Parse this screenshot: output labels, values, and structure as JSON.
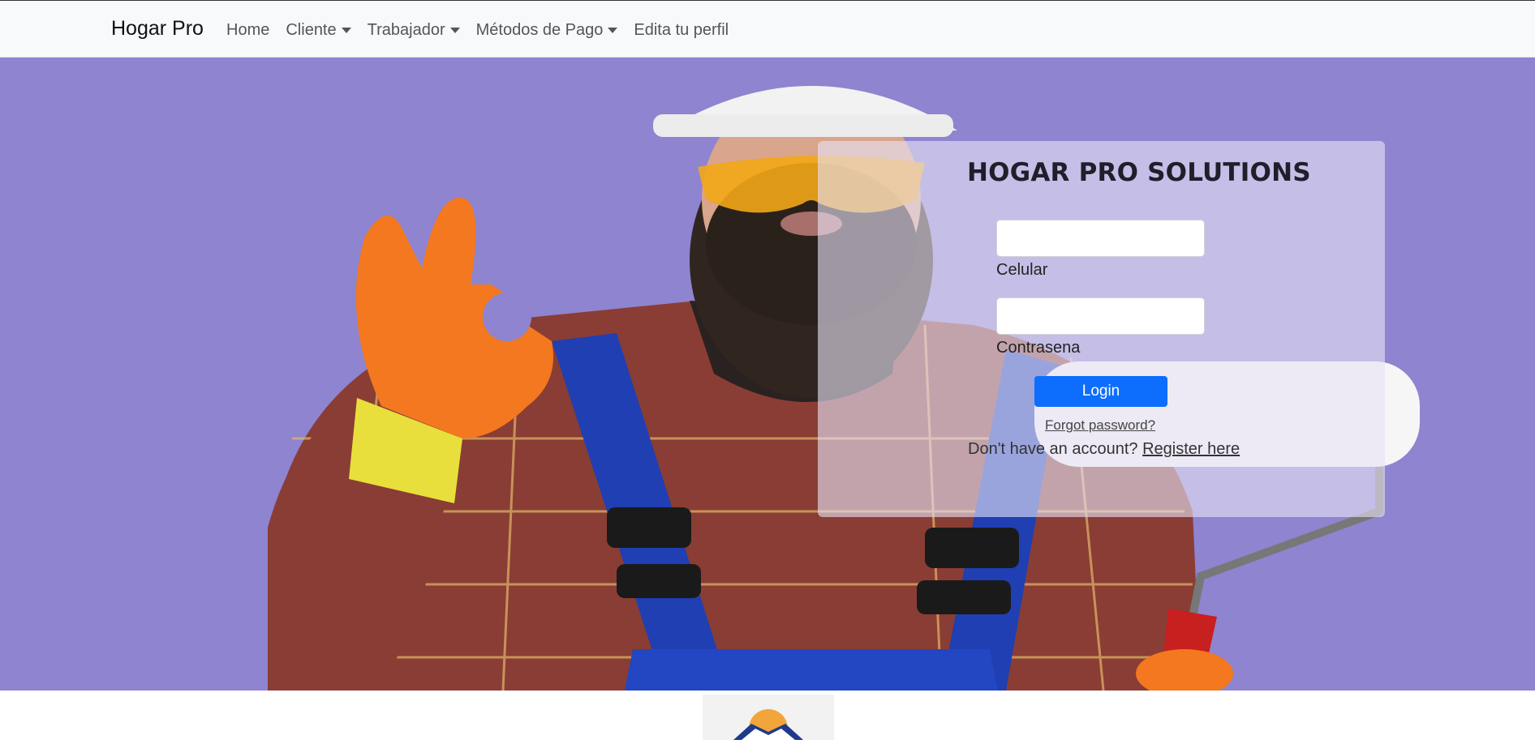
{
  "navbar": {
    "brand": "Hogar Pro",
    "items": [
      {
        "label": "Home",
        "dropdown": false
      },
      {
        "label": "Cliente",
        "dropdown": true
      },
      {
        "label": "Trabajador",
        "dropdown": true
      },
      {
        "label": "Métodos de Pago",
        "dropdown": true
      },
      {
        "label": "Edita tu perfil",
        "dropdown": false
      }
    ]
  },
  "login": {
    "title": "HOGAR PRO SOLUTIONS",
    "phone_value": "",
    "phone_label": "Celular",
    "password_value": "",
    "password_label": "Contrasena",
    "login_button": "Login",
    "forgot_link": "Forgot password?",
    "register_prompt": "Don't have an account?",
    "register_link": "Register here"
  },
  "colors": {
    "hero_background": "#8e84d0",
    "primary_button": "#0d6efd",
    "navbar_background": "#f8f9fa"
  },
  "hero_image": {
    "icon": "worker-photo"
  },
  "footer": {
    "icon": "house-logo-icon"
  }
}
